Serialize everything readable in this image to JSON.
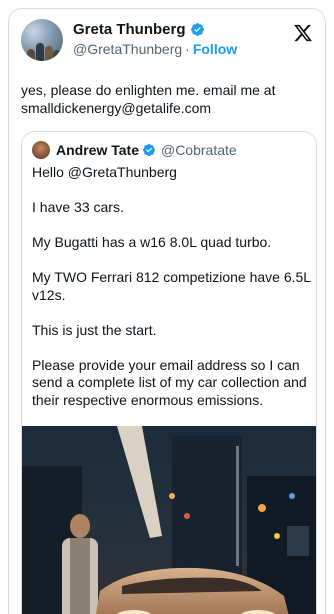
{
  "tweet": {
    "author_name": "Greta Thunberg",
    "author_handle": "@GretaThunberg",
    "separator": "·",
    "follow_label": "Follow",
    "text": "yes, please do enlighten me. email me at smalldickenergy@getalife.com"
  },
  "quoted": {
    "author_name": "Andrew Tate",
    "author_handle": "@Cobratate",
    "paragraphs": [
      "Hello @GretaThunberg",
      "I have 33 cars.",
      "My Bugatti has a w16 8.0L quad turbo.",
      "My TWO Ferrari 812 competizione have 6.5L v12s.",
      "This is just the start.",
      "Please provide your email address so I can send a complete list of my car collection and their respective enormous emissions."
    ]
  },
  "icons": {
    "verified": "verified-badge-icon",
    "logo": "x-logo-icon"
  },
  "colors": {
    "accent": "#1d9bf0",
    "text": "#0f1419",
    "muted": "#536471",
    "border": "#d9dde1"
  }
}
